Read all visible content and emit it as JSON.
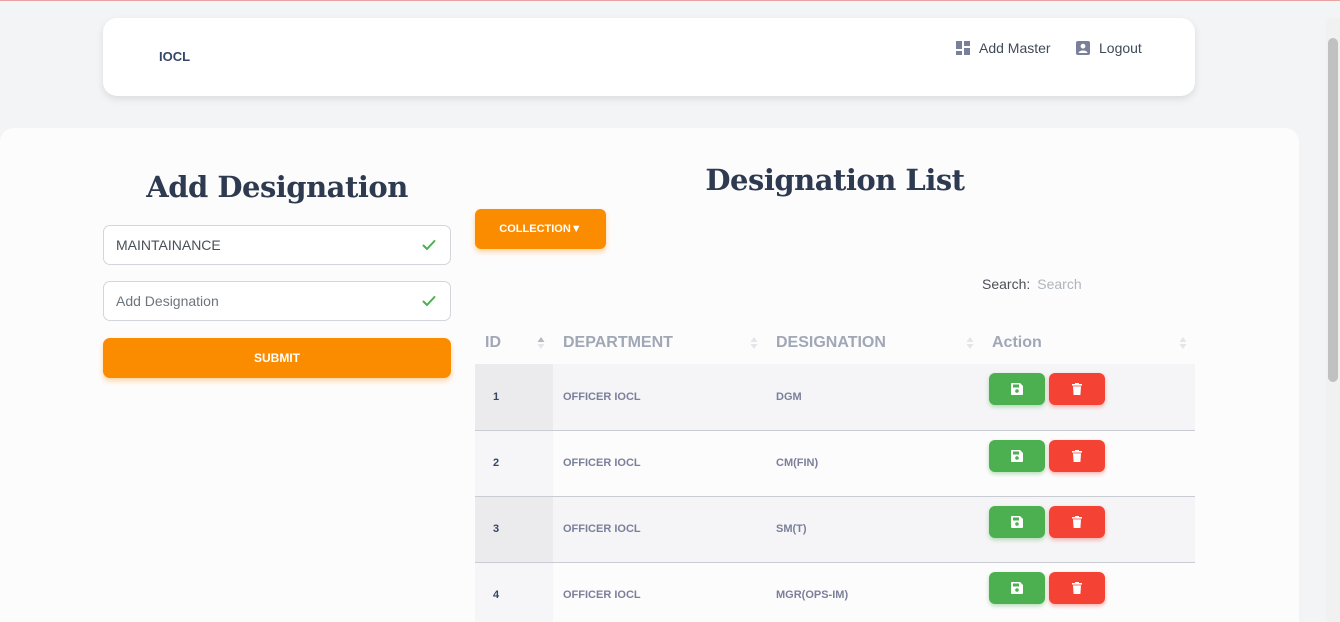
{
  "navbar": {
    "brand": "IOCL",
    "links": [
      {
        "label": "Add Master",
        "icon": "dashboard-icon"
      },
      {
        "label": "Logout",
        "icon": "user-box-icon"
      }
    ]
  },
  "form": {
    "title": "Add Designation",
    "department_value": "MAINTAINANCE",
    "designation_placeholder": "Add Designation",
    "submit_label": "SUBMIT"
  },
  "list": {
    "title": "Designation List",
    "collection_label": "COLLECTION▼",
    "search_label": "Search:",
    "search_placeholder": "Search",
    "columns": [
      "ID",
      "DEPARTMENT",
      "DESIGNATION",
      "Action"
    ],
    "rows": [
      {
        "id": "1",
        "department": "OFFICER IOCL",
        "designation": "DGM"
      },
      {
        "id": "2",
        "department": "OFFICER IOCL",
        "designation": "CM(FIN)"
      },
      {
        "id": "3",
        "department": "OFFICER IOCL",
        "designation": "SM(T)"
      },
      {
        "id": "4",
        "department": "OFFICER IOCL",
        "designation": "MGR(OPS-IM)"
      }
    ]
  },
  "colors": {
    "accent_orange": "#fb8c00",
    "save_green": "#4caf50",
    "delete_red": "#f44335",
    "check_green": "#4caf50"
  }
}
